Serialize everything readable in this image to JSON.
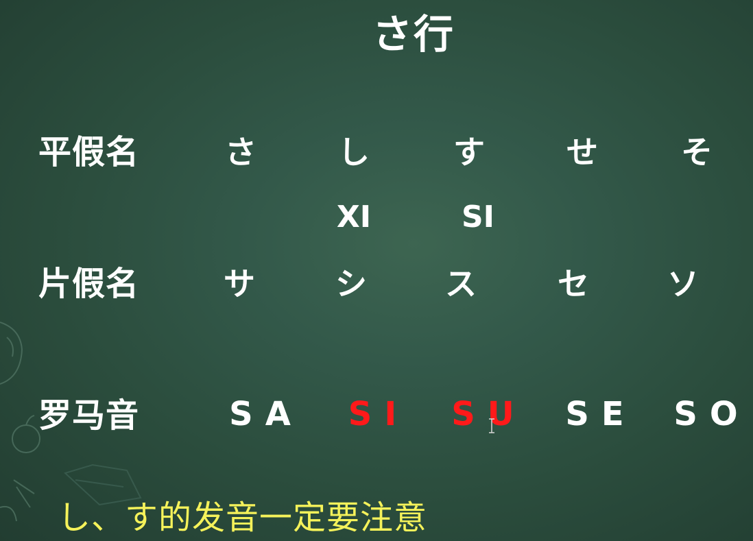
{
  "title": "さ行",
  "rows": {
    "hiragana": {
      "label": "平假名",
      "chars": [
        "さ",
        "し",
        "す",
        "せ",
        "そ"
      ]
    },
    "pinyin_notes": [
      "XI",
      "SI"
    ],
    "katakana": {
      "label": "片假名",
      "chars": [
        "サ",
        "シ",
        "ス",
        "セ",
        "ソ"
      ]
    },
    "romaji": {
      "label": "罗马音",
      "values": [
        "SA",
        "SI",
        "SU",
        "SE",
        "SO"
      ],
      "highlighted": [
        "SI",
        "SU"
      ]
    }
  },
  "note": "し、す的发音一定要注意",
  "colors": {
    "board": "#2f5444",
    "text": "#ffffff",
    "highlight": "#ff1a1a",
    "note": "#f5f25a"
  }
}
